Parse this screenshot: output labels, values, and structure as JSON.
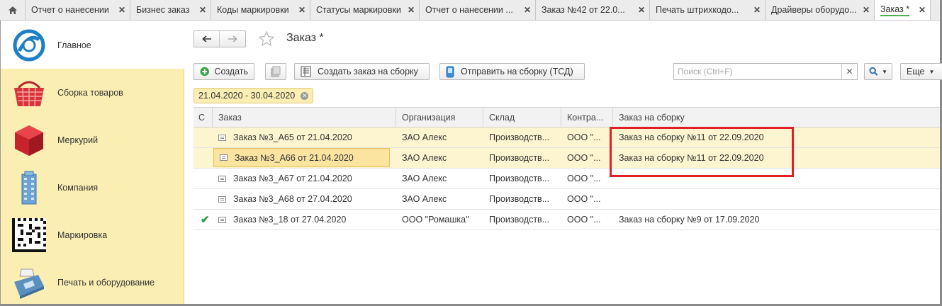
{
  "tabs": [
    {
      "label": "Отчет о нанесении"
    },
    {
      "label": "Бизнес заказ"
    },
    {
      "label": "Коды маркировки"
    },
    {
      "label": "Статусы маркировки"
    },
    {
      "label": "Отчет о нанесении ..."
    },
    {
      "label": "Заказ №42 от 22.0..."
    },
    {
      "label": "Печать штрихкодо..."
    },
    {
      "label": "Драйверы оборудо..."
    },
    {
      "label": "Заказ *",
      "active": true
    }
  ],
  "sidebar": {
    "items": [
      {
        "label": "Главное",
        "icon": "logo-icon"
      },
      {
        "label": "Сборка товаров",
        "icon": "basket-icon"
      },
      {
        "label": "Меркурий",
        "icon": "cube-icon"
      },
      {
        "label": "Компания",
        "icon": "building-icon"
      },
      {
        "label": "Маркировка",
        "icon": "datamatrix-icon"
      },
      {
        "label": "Печать и оборудование",
        "icon": "terminal-icon"
      }
    ]
  },
  "header": {
    "title": "Заказ *"
  },
  "toolbar": {
    "create_label": "Создать",
    "create_assembly_label": "Создать заказ на сборку",
    "send_assembly_label": "Отправить на сборку (ТСД)",
    "search_placeholder": "Поиск (Ctrl+F)",
    "more_label": "Еще"
  },
  "filter": {
    "period": "21.04.2020 - 30.04.2020"
  },
  "table": {
    "columns": [
      "С",
      "Заказ",
      "Организация",
      "Склад",
      "Контра...",
      "Заказ на сборку"
    ],
    "rows": [
      {
        "status": "",
        "order": "Заказ №3_А65 от 21.04.2020",
        "org": "ЗАО Алекс",
        "warehouse": "Производств...",
        "contractor": "ООО \"...",
        "assembly": "Заказ на сборку №11 от 22.09.2020"
      },
      {
        "status": "",
        "order": "Заказ №3_А66 от 21.04.2020",
        "org": "ЗАО Алекс",
        "warehouse": "Производств...",
        "contractor": "ООО \"...",
        "assembly": "Заказ на сборку №11 от 22.09.2020"
      },
      {
        "status": "",
        "order": "Заказ №3_А67 от 21.04.2020",
        "org": "ЗАО Алекс",
        "warehouse": "Производств...",
        "contractor": "ООО \"...",
        "assembly": ""
      },
      {
        "status": "",
        "order": "Заказ №3_А68 от 27.04.2020",
        "org": "ЗАО Алекс",
        "warehouse": "Производств...",
        "contractor": "ООО \"...",
        "assembly": ""
      },
      {
        "status": "✔",
        "order": "Заказ №3_18 от 27.04.2020",
        "org": "ООО \"Ромашка\"",
        "warehouse": "Производств...",
        "contractor": "ООО \"...",
        "assembly": "Заказ на сборку №9 от 17.09.2020"
      }
    ]
  },
  "colors": {
    "sidebar_bg": "#fbeeb3",
    "highlight_row": "#fdf5d0",
    "red_annotation": "#e01f26",
    "check_green": "#2e9a3e"
  }
}
